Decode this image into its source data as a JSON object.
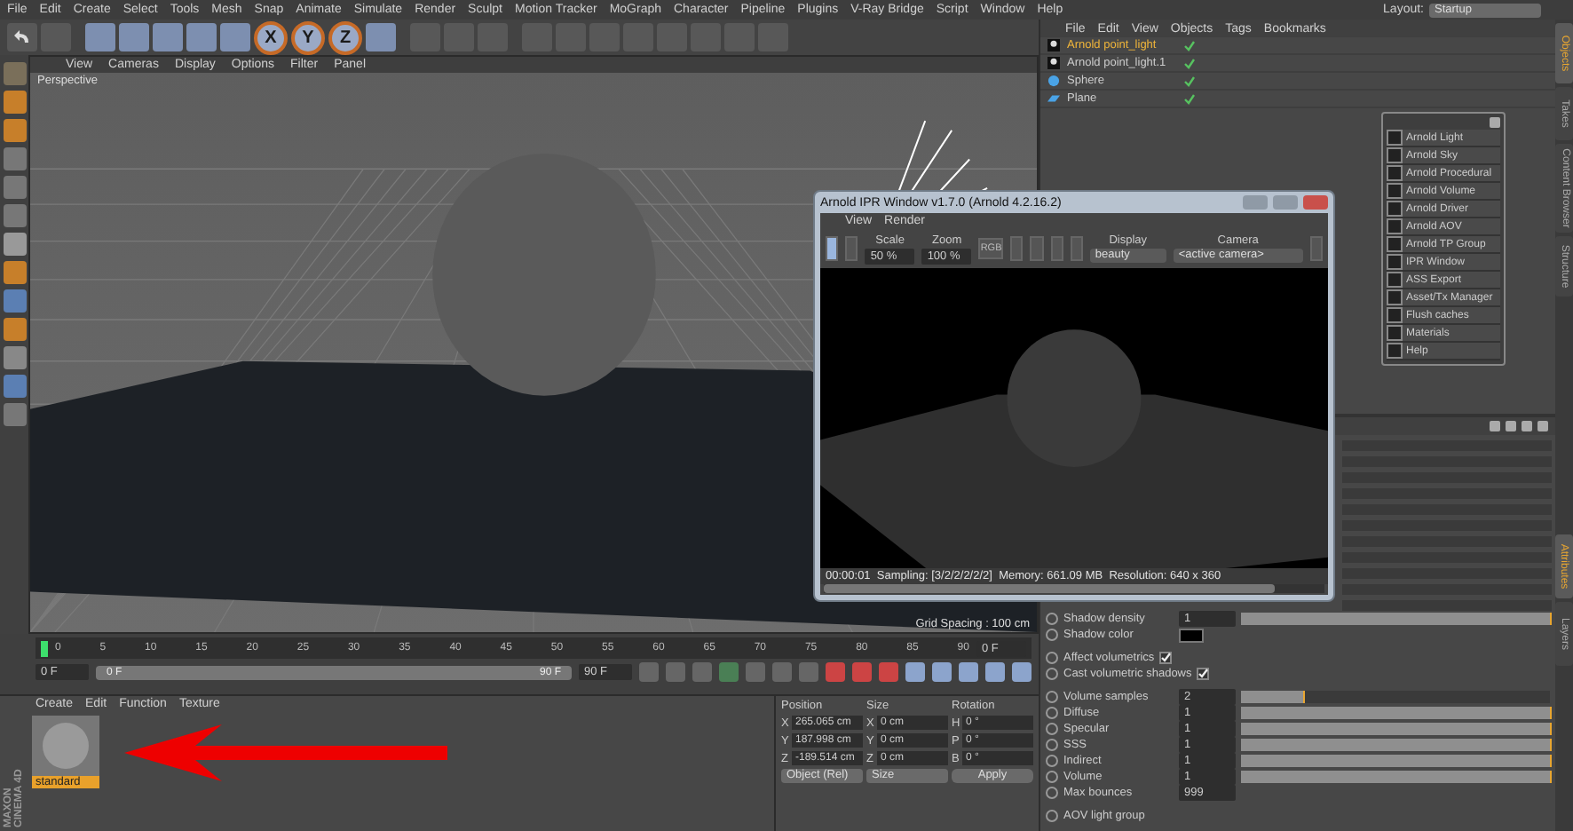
{
  "menu_bar": [
    "File",
    "Edit",
    "Create",
    "Select",
    "Tools",
    "Mesh",
    "Snap",
    "Animate",
    "Simulate",
    "Render",
    "Sculpt",
    "Motion Tracker",
    "MoGraph",
    "Character",
    "Pipeline",
    "Plugins",
    "V-Ray Bridge",
    "Script",
    "Window",
    "Help"
  ],
  "layout": {
    "label": "Layout:",
    "value": "Startup"
  },
  "toolbar": {
    "axis_buttons": [
      "X",
      "Y",
      "Z"
    ]
  },
  "viewport": {
    "menu": [
      "View",
      "Cameras",
      "Display",
      "Options",
      "Filter",
      "Panel"
    ],
    "camera_label": "Perspective",
    "grid_spacing": "Grid Spacing : 100 cm"
  },
  "timeline": {
    "ticks": [
      "0",
      "5",
      "10",
      "15",
      "20",
      "25",
      "30",
      "35",
      "40",
      "45",
      "50",
      "55",
      "60",
      "65",
      "70",
      "75",
      "80",
      "85",
      "90"
    ],
    "current_frame": "0 F",
    "start_field": "0 F",
    "range": {
      "start": "0 F",
      "end": "90 F",
      "level": 1
    },
    "end_field": "90 F"
  },
  "material_manager": {
    "menu": [
      "Create",
      "Edit",
      "Function",
      "Texture"
    ],
    "materials": [
      {
        "name": "standard",
        "selected": true
      }
    ]
  },
  "coordinates": {
    "columns": [
      "Position",
      "Size",
      "Rotation"
    ],
    "rows": [
      {
        "axis": "X",
        "position": "265.065 cm",
        "size_axis": "X",
        "size": "0 cm",
        "rotation_axis": "H",
        "rotation": "0 °"
      },
      {
        "axis": "Y",
        "position": "187.998 cm",
        "size_axis": "Y",
        "size": "0 cm",
        "rotation_axis": "P",
        "rotation": "0 °"
      },
      {
        "axis": "Z",
        "position": "-189.514 cm",
        "size_axis": "Z",
        "size": "0 cm",
        "rotation_axis": "B",
        "rotation": "0 °"
      }
    ],
    "mode": "Object (Rel)",
    "size_mode": "Size",
    "apply": "Apply"
  },
  "object_manager": {
    "menu": [
      "File",
      "Edit",
      "View",
      "Objects",
      "Tags",
      "Bookmarks"
    ],
    "objects": [
      {
        "name": "Arnold point_light",
        "kind": "light",
        "selected": true
      },
      {
        "name": "Arnold point_light.1",
        "kind": "light",
        "selected": false
      },
      {
        "name": "Sphere",
        "kind": "sphere",
        "selected": false
      },
      {
        "name": "Plane",
        "kind": "plane",
        "selected": false
      }
    ]
  },
  "side_tabs": [
    {
      "label": "Objects",
      "selected": true
    },
    {
      "label": "Takes",
      "selected": false
    },
    {
      "label": "Content Browser",
      "selected": false
    },
    {
      "label": "Structure",
      "selected": false
    }
  ],
  "attribute_tabs": [
    {
      "label": "Attributes",
      "selected": true
    },
    {
      "label": "Layers",
      "selected": false
    }
  ],
  "attributes": [
    {
      "kind": "slider",
      "label": "Shadow density",
      "value": "1",
      "level": 1
    },
    {
      "kind": "color",
      "label": "Shadow color",
      "color": "#000000"
    },
    {
      "kind": "check",
      "label": "Affect volumetrics",
      "checked": true
    },
    {
      "kind": "check",
      "label": "Cast volumetric shadows",
      "checked": true
    },
    {
      "kind": "slider",
      "label": "Volume samples",
      "value": "2",
      "level": 0.2
    },
    {
      "kind": "slider",
      "label": "Diffuse",
      "value": "1",
      "level": 1
    },
    {
      "kind": "slider",
      "label": "Specular",
      "value": "1",
      "level": 1
    },
    {
      "kind": "slider",
      "label": "SSS",
      "value": "1",
      "level": 1
    },
    {
      "kind": "slider",
      "label": "Indirect",
      "value": "1",
      "level": 1
    },
    {
      "kind": "slider",
      "label": "Volume",
      "value": "1",
      "level": 1
    },
    {
      "kind": "field",
      "label": "Max bounces",
      "value": "999"
    },
    {
      "kind": "group",
      "label": "AOV light group"
    }
  ],
  "arnold_menu": {
    "items": [
      "Arnold Light",
      "Arnold Sky",
      "Arnold Procedural",
      "Arnold Volume",
      "Arnold Driver",
      "Arnold AOV",
      "Arnold TP Group",
      "IPR Window",
      "ASS Export",
      "Asset/Tx Manager",
      "Flush caches",
      "Materials",
      "Help"
    ]
  },
  "ipr_window": {
    "title": "Arnold IPR Window v1.7.0 (Arnold 4.2.16.2)",
    "menu": [
      "View",
      "Render"
    ],
    "scale_label": "Scale",
    "scale": "50 %",
    "zoom_label": "Zoom",
    "zoom": "100 %",
    "rgb": "RGB",
    "display_label": "Display",
    "display": "beauty",
    "camera_label": "Camera",
    "camera": "<active camera>",
    "status": "00:00:01  Sampling: [3/2/2/2/2/2]  Memory: 661.09 MB  Resolution: 640 x 360"
  },
  "logo": [
    "MAXON",
    "CINEMA 4D"
  ]
}
